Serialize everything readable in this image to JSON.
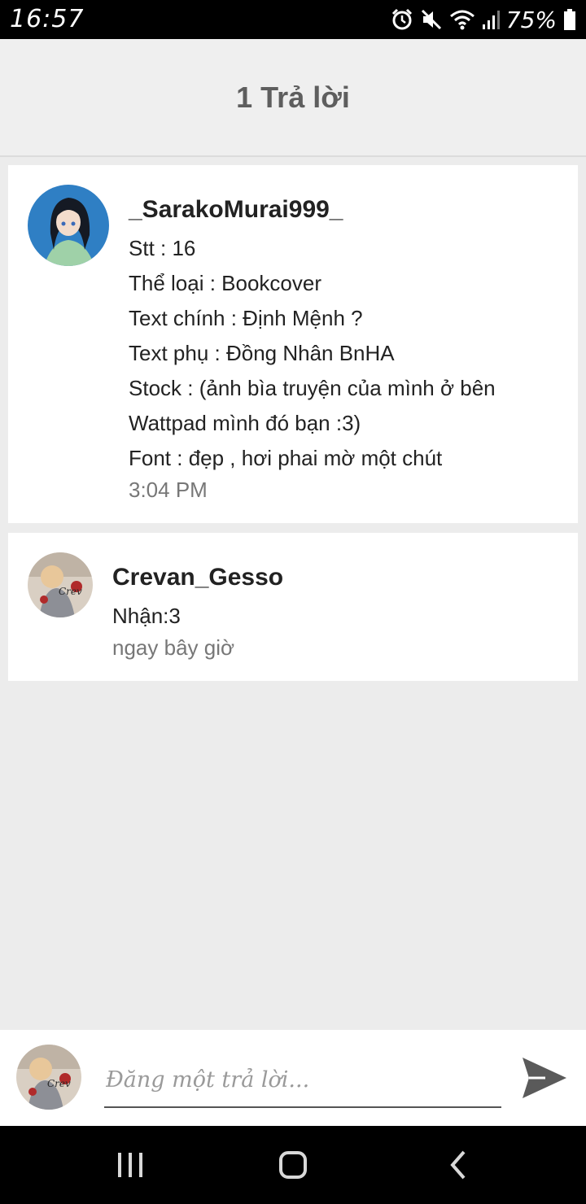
{
  "status_bar": {
    "time": "16:57",
    "battery": "75%",
    "icons": [
      "alarm-icon",
      "mute-icon",
      "wifi-icon",
      "signal-icon",
      "battery-icon"
    ]
  },
  "header": {
    "title": "1 Trả lời"
  },
  "comments": [
    {
      "username": "_SarakoMurai999_",
      "lines": [
        "Stt : 16",
        "Thể loại : Bookcover",
        "Text chính : Định Mệnh ?",
        "Text phụ : Đồng Nhân BnHA",
        "Stock : (ảnh bìa truyện của mình ở bên",
        "Wattpad mình đó bạn :3)",
        "Font : đẹp , hơi phai mờ một chút"
      ],
      "time": "3:04 PM"
    },
    {
      "username": "Crevan_Gesso",
      "lines": [
        "Nhận:3"
      ],
      "time": "ngay bây giờ"
    }
  ],
  "reply": {
    "placeholder": "Đăng một trả lời..."
  },
  "colors": {
    "background": "#ececec",
    "card": "#ffffff",
    "send_icon": "#5a5a5a"
  }
}
